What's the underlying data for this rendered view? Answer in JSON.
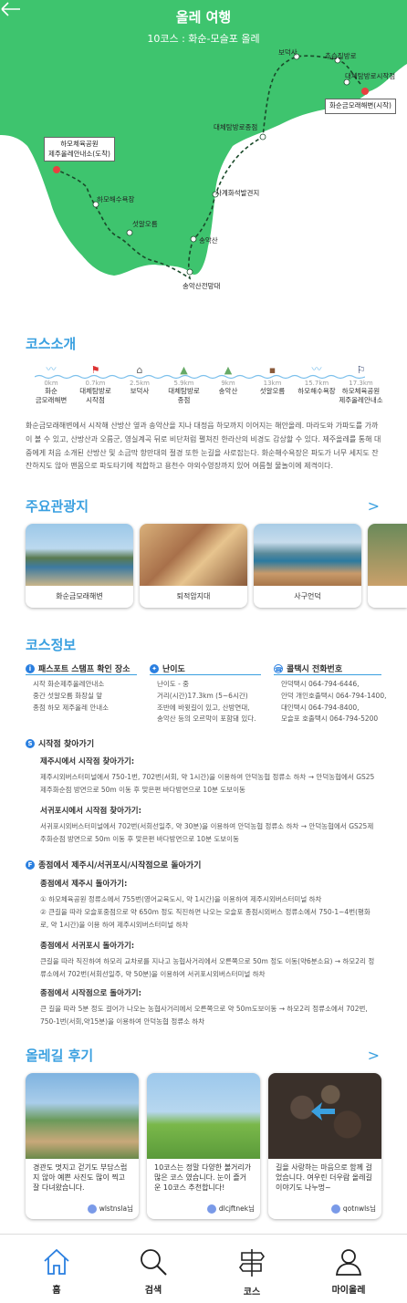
{
  "header": {
    "title": "올레 여행",
    "subtitle": "10코스 : 화순-모슬포 올레"
  },
  "map": {
    "labels": [
      "보덕사",
      "추습질방로",
      "대체탐방로시작점",
      "화순금모래해변(시작)",
      "대체탐방로종점",
      "사계화석발견지",
      "하모해수욕장",
      "섯알오름",
      "송악산",
      "송악산전망대"
    ],
    "end_label": [
      "하모체육공원",
      "제주올레안내소(도착)"
    ]
  },
  "intro": {
    "title": "코스소개",
    "stops": [
      {
        "km": "0km",
        "name": "화순\n금모래해변"
      },
      {
        "km": "0.7km",
        "name": "대체탐방로\n시작점"
      },
      {
        "km": "2.5km",
        "name": "보덕사"
      },
      {
        "km": "5.9km",
        "name": "대체탐방로\n종점"
      },
      {
        "km": "9km",
        "name": "송악산"
      },
      {
        "km": "13km",
        "name": "섯알오름"
      },
      {
        "km": "15.7km",
        "name": "하모해수욕장"
      },
      {
        "km": "17.3km",
        "name": "하모체육공원\n제주올레안내소"
      }
    ],
    "text": "화순금모래해변에서 시작해 산방산 옆과 송악산을 지나 대정읍 하모까지 이어지는 해안올레. 마라도와 가파도를 가까이 볼 수 있고, 산방산과 오름군, 영실계곡 뒤로 비단처럼 펼쳐진 한라산의 비경도 감상할 수 있다. 제주올레를 통해 대중에게 처음 소개된 산방산 및 소금막 항만대의 절경 또한 눈길을 사로잡는다. 화순해수욕장은 파도가 너무 세지도 잔잔하지도 않아 맨몸으로 파도타기에 적합하고 용천수 야외수영장까지 있어 여름철 물놀이에 제격이다."
  },
  "spots": {
    "title": "주요관광지",
    "chevron": ">",
    "items": [
      "화순금모래해변",
      "퇴적암지대",
      "사구언덕"
    ]
  },
  "info": {
    "title": "코스정보",
    "cols": [
      {
        "head": "패스포트 스탬프 확인 장소",
        "lines": [
          "시작 화순제주올레안내소",
          "중간 섯알오름 화장실 앞",
          "종점 하모 제주올레 안내소"
        ]
      },
      {
        "head": "난이도",
        "lines": [
          "난이도 - 중",
          "거리(시간)17.3km (5~6시간)",
          "조반에 바윗길이 있고, 산방연대,",
          "송악산 등의 오르막이 포함돼 있다."
        ]
      },
      {
        "head": "콜택시 전화번호",
        "lines": [
          "안덕택시 064-794-6446,",
          "안덕 개인호출택시 064-794-1400,",
          "대인택시 064-794-8400,",
          "모슬포 호출택시 064-794-5200"
        ]
      }
    ],
    "start": {
      "head": "시작점 찾아가기",
      "h1": "제주시에서 시작점 찾아가기:",
      "p1": "제주시외버스터미널에서 750-1번, 702번(서회, 약 1시간)을 이용하여 안덕농협 정류소 하차 → 안덕농협에서 GS25제주화순점 방면으로 50m 이동 후 맞은편 바다방면으로 10분 도보이동",
      "h2": "서귀포시에서 시작점 찾아가기:",
      "p2": "서귀포시외버스터미널에서 702번(서회선일주, 약 30분)을 이용하여 안덕농협 정류소 하차 → 안덕농협에서 GS25제주화순점 방면으로 50m 이동 후 맞은편 바다방면으로 10분 도보이동"
    },
    "end": {
      "head": "종점에서 제주시/서귀포시/시작점으로 돌아가기",
      "h1": "종점에서 제주시 돌아가기:",
      "p1": "① 하모체육공원 정류소에서 755번(영어교육도시, 약 1시간)을 이용하여 제주시외버스터미널 하차\n② 큰길을 따라 모슬포중점으로 약 650m 정도 직진하면 나오는 모슬포 종점시외버스 정류소에서 750-1~4번(평화로, 약 1시간)을 이용   하여 제주시외버스터미널 하차",
      "h2": "종점에서 서귀포시 돌아가기:",
      "p2": "큰길을 따라 직진하여 하모리 교차로를 지나고 농협사거리에서 오른쪽으로 50m 정도 이동(약6분소요) → 하모2리 정류소에서 702번(서회선일주, 약 50분)을 이용하여 서귀포시외버스터미널 하차",
      "h3": "종점에서 시작점으로 돌아가기:",
      "p3": "큰 길을 따라 5분 정도 걸어가 나오는 농협사거리에서 오른쪽으로 약 50m도보이동 → 하모2리 정류소에서 702번, 750-1번(서회,약15분)을 이용하여 안덕농협 정류소 하차"
    }
  },
  "reviews": {
    "title": "올레길 후기",
    "chevron": ">",
    "items": [
      {
        "text": "경관도 멋지고 걷기도 부담스럽지 않아 예쁜 사진도 많이 찍고 잘 다녀왔습니다.",
        "user": "wlstnsla님"
      },
      {
        "text": "10코스는 정말 다양한 볼거리가 많은 코스 였습니다. 눈이 즐거운 10코스 추천합니다!",
        "user": "dlcjftnek님"
      },
      {
        "text": "길을 사랑하는 마음으로 함께 걸었습니다. 여우린 더우람 올레길 이야기도 나누멍~",
        "user": "qotnwls님"
      }
    ]
  },
  "tabs": [
    "홈",
    "검색",
    "코스",
    "마이올레"
  ],
  "colors": {
    "map_green": "#3ec46e",
    "accent": "#3aa0e0",
    "route": "#1a4a2a",
    "marker": "#e84040"
  }
}
